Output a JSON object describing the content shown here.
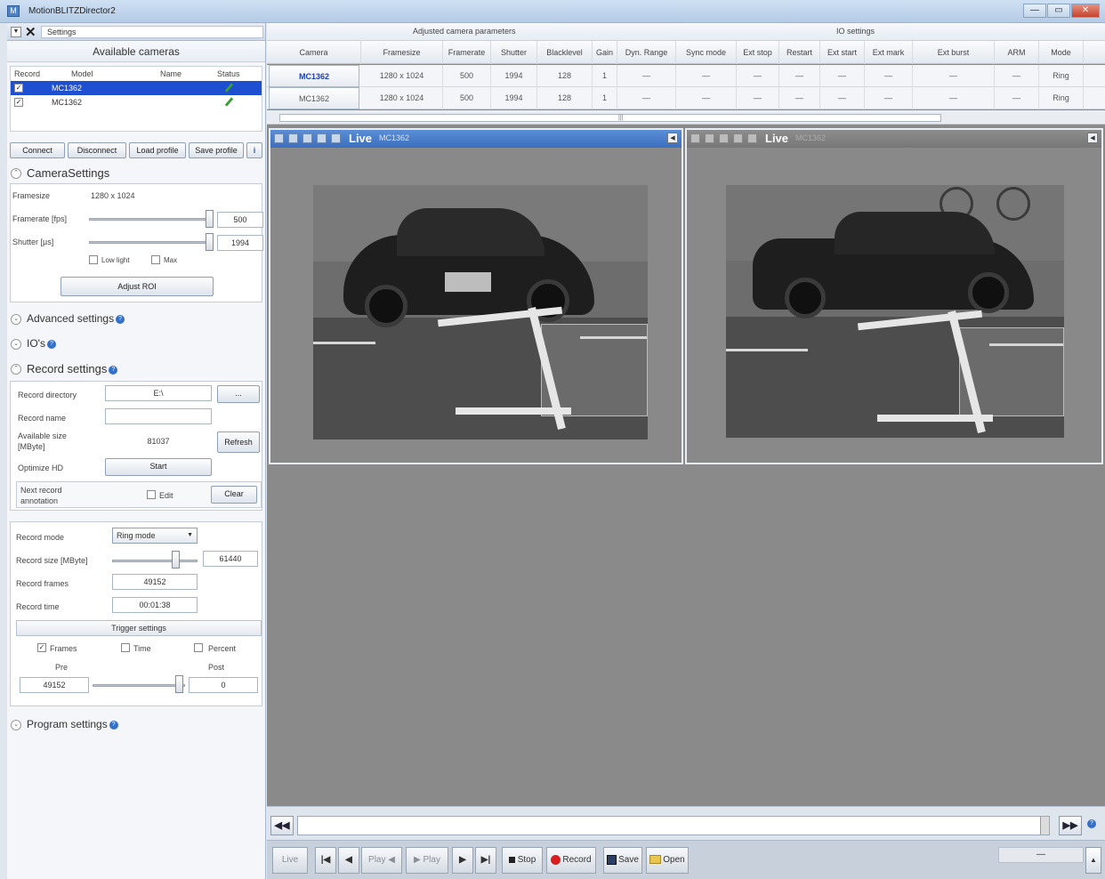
{
  "window": {
    "title": "MotionBLITZDirector2",
    "minimize": "—",
    "maximize": "▭",
    "close": "✕"
  },
  "settings_tab": "Settings",
  "available_cameras": {
    "title": "Available cameras",
    "headers": [
      "Record",
      "Model",
      "Name",
      "Status"
    ],
    "rows": [
      {
        "record": "✓",
        "model": "MC1362",
        "name": "",
        "selected": true
      },
      {
        "record": "✓",
        "model": "MC1362",
        "name": "",
        "selected": false
      }
    ]
  },
  "buttons": {
    "connect": "Connect",
    "disconnect": "Disconnect",
    "load_profile": "Load profile",
    "save_profile": "Save profile",
    "info": "i"
  },
  "camera_settings": {
    "title": "CameraSettings",
    "framesize_label": "Framesize",
    "framesize_value": "1280 x 1024",
    "framerate_label": "Framerate [fps]",
    "framerate_value": "500",
    "shutter_label": "Shutter [µs]",
    "shutter_value": "1994",
    "low_light": "Low light",
    "max": "Max",
    "adjust_roi": "Adjust ROI"
  },
  "advanced_settings": "Advanced settings",
  "ios": "IO's",
  "record_settings": {
    "title": "Record settings",
    "directory_label": "Record directory",
    "directory_value": "E:\\",
    "browse": "...",
    "name_label": "Record name",
    "name_value": "",
    "avail_label1": "Available size",
    "avail_label2": "[MByte]",
    "avail_value": "81037",
    "refresh": "Refresh",
    "optimize_label": "Optimize HD",
    "start": "Start",
    "annotation_label1": "Next record",
    "annotation_label2": "annotation",
    "edit": "Edit",
    "clear": "Clear",
    "mode_label": "Record mode",
    "mode_value": "Ring mode",
    "size_label": "Record size [MByte]",
    "size_value": "61440",
    "frames_label": "Record frames",
    "frames_value": "49152",
    "time_label": "Record time",
    "time_value": "00:01:38",
    "trigger_title": "Trigger settings",
    "trig_frames": "Frames",
    "trig_time": "Time",
    "trig_percent": "Percent",
    "pre_label": "Pre",
    "post_label": "Post",
    "pre_value": "49152",
    "post_value": "0"
  },
  "program_settings": "Program settings",
  "param_table": {
    "group_adjusted": "Adjusted camera parameters",
    "group_io": "IO settings",
    "headers": [
      "Camera",
      "Framesize",
      "Framerate",
      "Shutter",
      "Blacklevel",
      "Gain",
      "Dyn. Range",
      "Sync mode",
      "Ext stop",
      "Restart",
      "Ext start",
      "Ext mark",
      "Ext burst",
      "ARM",
      "Mode"
    ],
    "rows": [
      [
        "MC1362",
        "1280 x 1024",
        "500",
        "1994",
        "128",
        "1",
        "—",
        "—",
        "—",
        "—",
        "—",
        "—",
        "—",
        "—",
        "Ring"
      ],
      [
        "MC1362",
        "1280 x 1024",
        "500",
        "1994",
        "128",
        "1",
        "—",
        "—",
        "—",
        "—",
        "—",
        "—",
        "—",
        "—",
        "Ring"
      ]
    ]
  },
  "live_views": [
    {
      "label": "Live",
      "camera": "MC1362"
    },
    {
      "label": "Live",
      "camera": "MC1362"
    }
  ],
  "controls": {
    "live": "Live",
    "play_back": "Play",
    "play": "Play",
    "stop": "Stop",
    "record": "Record",
    "save": "Save",
    "open": "Open",
    "status": "—"
  },
  "colors": {
    "selection": "#1e4fd0",
    "live_bar": "#4a7fcc",
    "record": "#d81e1e"
  }
}
